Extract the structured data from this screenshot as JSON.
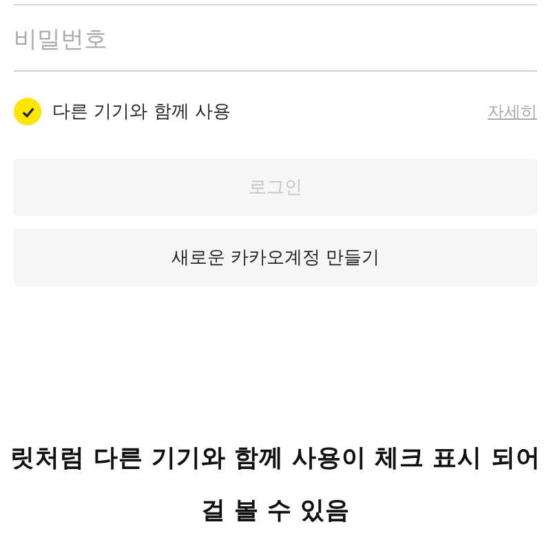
{
  "password_field": {
    "placeholder": "비밀번호"
  },
  "keep_signed": {
    "label": "다른 기기와 함께 사용",
    "checked": true,
    "details_link": "자세히"
  },
  "login_button": {
    "label": "로그인",
    "disabled": true
  },
  "signup_button": {
    "label": "새로운 카카오계정 만들기"
  },
  "caption": [
    "릿처럼 다른 기기와 함께 사용이 체크 표시 되어",
    "걸 볼 수 있음"
  ]
}
